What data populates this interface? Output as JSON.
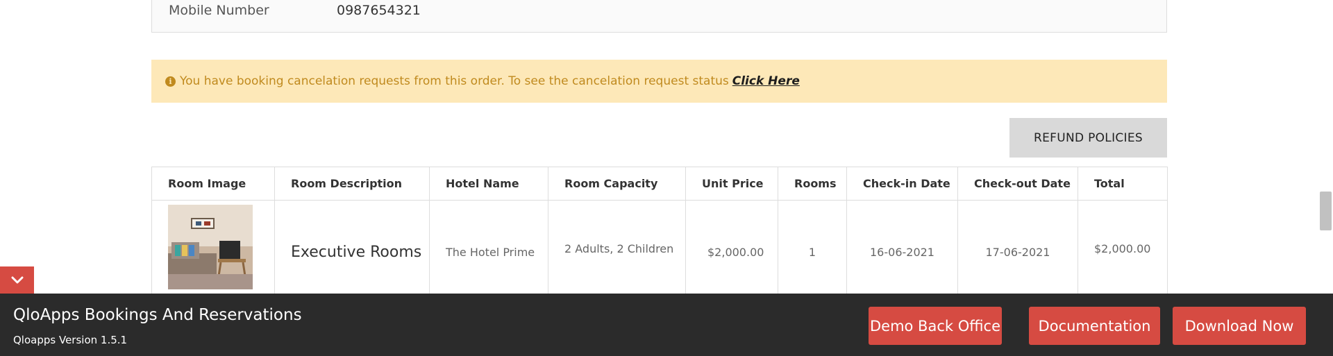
{
  "customer_info": {
    "mobile_label": "Mobile Number",
    "mobile_value": "0987654321"
  },
  "alert": {
    "icon": "info-circle-icon",
    "message": "You have booking cancelation requests from this order. To see the cancelation request status",
    "link_text": "Click Here",
    "color": "#c08a1e",
    "background": "#fde8b8"
  },
  "refund_button": {
    "label": "REFUND POLICIES"
  },
  "table": {
    "headers": [
      "Room Image",
      "Room Description",
      "Hotel Name",
      "Room Capacity",
      "Unit Price",
      "Rooms",
      "Check-in Date",
      "Check-out Date",
      "Total"
    ],
    "rows": [
      {
        "room_description": "Executive Rooms",
        "hotel_name": "The Hotel Prime",
        "room_capacity": "2 Adults, 2 Children",
        "unit_price": "$2,000.00",
        "rooms": "1",
        "check_in": "16-06-2021",
        "check_out": "17-06-2021",
        "total": "$2,000.00"
      }
    ]
  },
  "footer": {
    "title": "QloApps Bookings And Reservations",
    "version": "Qloapps Version 1.5.1",
    "buttons": {
      "demo": "Demo Back Office",
      "docs": "Documentation",
      "download": "Download Now"
    },
    "accent_color": "#d64b42",
    "background": "#2b2b2b"
  },
  "toggle": {
    "icon": "chevron-down-icon"
  }
}
